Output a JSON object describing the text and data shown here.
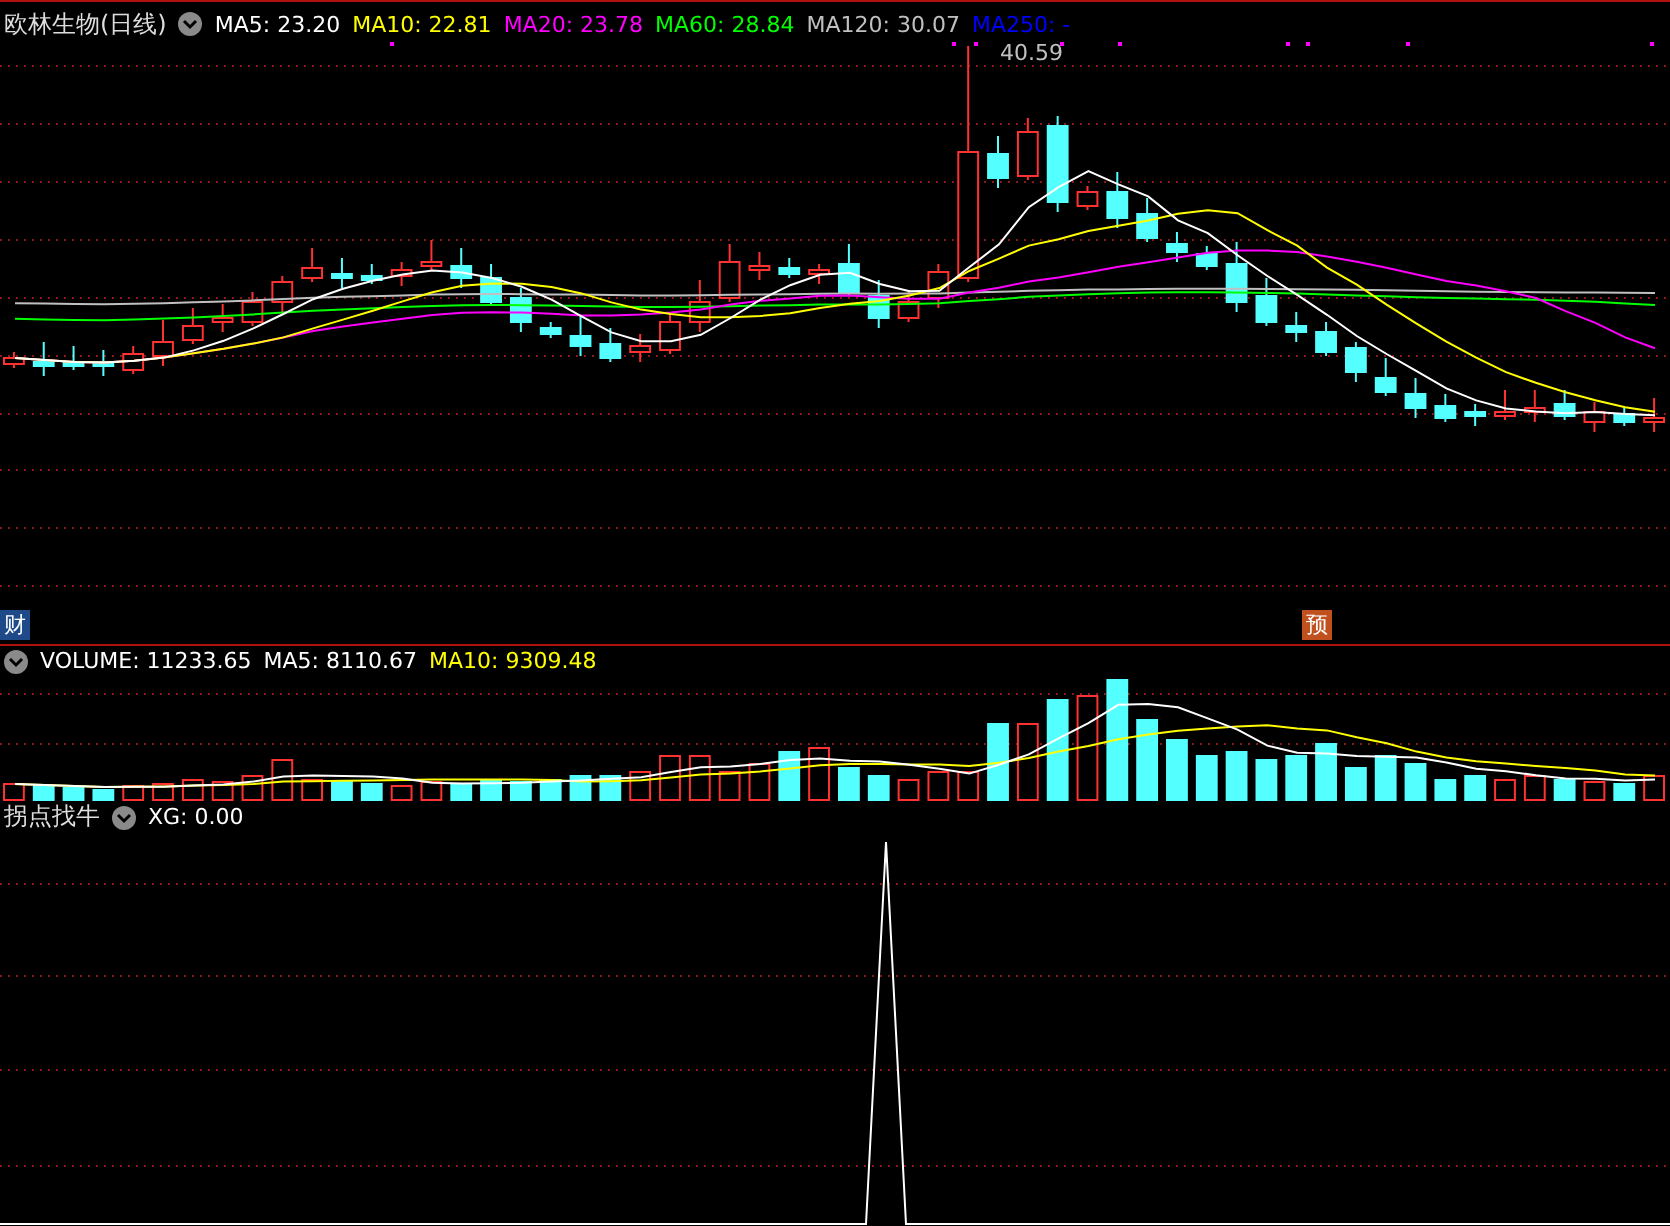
{
  "price_panel": {
    "title": "欧林生物(日线)",
    "legend": [
      {
        "label": "MA5: 23.20",
        "color": "#ffffff"
      },
      {
        "label": "MA10: 22.81",
        "color": "#ffff00"
      },
      {
        "label": "MA20: 23.78",
        "color": "#ff00ff"
      },
      {
        "label": "MA60: 28.84",
        "color": "#00ff00"
      },
      {
        "label": "MA120: 30.07",
        "color": "#c0c0c0"
      },
      {
        "label": "MA250: -",
        "color": "#0000ff"
      }
    ],
    "high_label": "40.59",
    "event_badges": [
      {
        "label": "财",
        "color": "#1f4a8a"
      },
      {
        "label": "预",
        "color": "#c0501e"
      }
    ]
  },
  "volume_panel": {
    "legend": [
      {
        "label": "VOLUME: 11233.65",
        "color": "#ffffff"
      },
      {
        "label": "MA5: 8110.67",
        "color": "#ffffff"
      },
      {
        "label": "MA10: 9309.48",
        "color": "#ffff00"
      }
    ]
  },
  "indicator_panel": {
    "title": "拐点找牛",
    "legend": [
      {
        "label": "XG: 0.00",
        "color": "#ffffff"
      }
    ]
  }
}
